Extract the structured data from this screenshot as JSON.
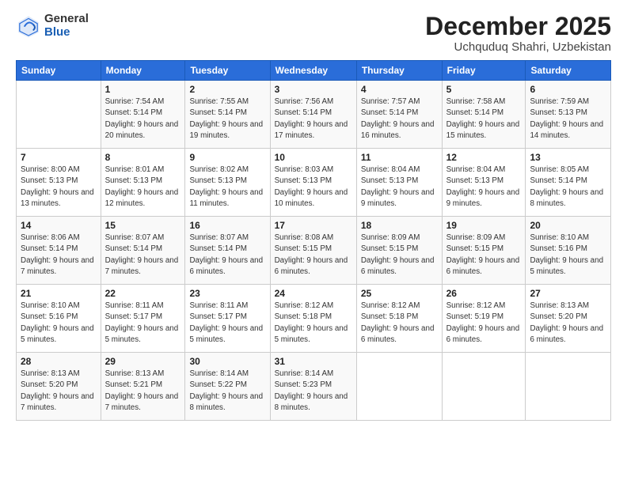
{
  "logo": {
    "general": "General",
    "blue": "Blue"
  },
  "header": {
    "month": "December 2025",
    "location": "Uchquduq Shahri, Uzbekistan"
  },
  "weekdays": [
    "Sunday",
    "Monday",
    "Tuesday",
    "Wednesday",
    "Thursday",
    "Friday",
    "Saturday"
  ],
  "weeks": [
    [
      {
        "day": "",
        "sunrise": "",
        "sunset": "",
        "daylight": ""
      },
      {
        "day": "1",
        "sunrise": "Sunrise: 7:54 AM",
        "sunset": "Sunset: 5:14 PM",
        "daylight": "Daylight: 9 hours and 20 minutes."
      },
      {
        "day": "2",
        "sunrise": "Sunrise: 7:55 AM",
        "sunset": "Sunset: 5:14 PM",
        "daylight": "Daylight: 9 hours and 19 minutes."
      },
      {
        "day": "3",
        "sunrise": "Sunrise: 7:56 AM",
        "sunset": "Sunset: 5:14 PM",
        "daylight": "Daylight: 9 hours and 17 minutes."
      },
      {
        "day": "4",
        "sunrise": "Sunrise: 7:57 AM",
        "sunset": "Sunset: 5:14 PM",
        "daylight": "Daylight: 9 hours and 16 minutes."
      },
      {
        "day": "5",
        "sunrise": "Sunrise: 7:58 AM",
        "sunset": "Sunset: 5:14 PM",
        "daylight": "Daylight: 9 hours and 15 minutes."
      },
      {
        "day": "6",
        "sunrise": "Sunrise: 7:59 AM",
        "sunset": "Sunset: 5:13 PM",
        "daylight": "Daylight: 9 hours and 14 minutes."
      }
    ],
    [
      {
        "day": "7",
        "sunrise": "Sunrise: 8:00 AM",
        "sunset": "Sunset: 5:13 PM",
        "daylight": "Daylight: 9 hours and 13 minutes."
      },
      {
        "day": "8",
        "sunrise": "Sunrise: 8:01 AM",
        "sunset": "Sunset: 5:13 PM",
        "daylight": "Daylight: 9 hours and 12 minutes."
      },
      {
        "day": "9",
        "sunrise": "Sunrise: 8:02 AM",
        "sunset": "Sunset: 5:13 PM",
        "daylight": "Daylight: 9 hours and 11 minutes."
      },
      {
        "day": "10",
        "sunrise": "Sunrise: 8:03 AM",
        "sunset": "Sunset: 5:13 PM",
        "daylight": "Daylight: 9 hours and 10 minutes."
      },
      {
        "day": "11",
        "sunrise": "Sunrise: 8:04 AM",
        "sunset": "Sunset: 5:13 PM",
        "daylight": "Daylight: 9 hours and 9 minutes."
      },
      {
        "day": "12",
        "sunrise": "Sunrise: 8:04 AM",
        "sunset": "Sunset: 5:13 PM",
        "daylight": "Daylight: 9 hours and 9 minutes."
      },
      {
        "day": "13",
        "sunrise": "Sunrise: 8:05 AM",
        "sunset": "Sunset: 5:14 PM",
        "daylight": "Daylight: 9 hours and 8 minutes."
      }
    ],
    [
      {
        "day": "14",
        "sunrise": "Sunrise: 8:06 AM",
        "sunset": "Sunset: 5:14 PM",
        "daylight": "Daylight: 9 hours and 7 minutes."
      },
      {
        "day": "15",
        "sunrise": "Sunrise: 8:07 AM",
        "sunset": "Sunset: 5:14 PM",
        "daylight": "Daylight: 9 hours and 7 minutes."
      },
      {
        "day": "16",
        "sunrise": "Sunrise: 8:07 AM",
        "sunset": "Sunset: 5:14 PM",
        "daylight": "Daylight: 9 hours and 6 minutes."
      },
      {
        "day": "17",
        "sunrise": "Sunrise: 8:08 AM",
        "sunset": "Sunset: 5:15 PM",
        "daylight": "Daylight: 9 hours and 6 minutes."
      },
      {
        "day": "18",
        "sunrise": "Sunrise: 8:09 AM",
        "sunset": "Sunset: 5:15 PM",
        "daylight": "Daylight: 9 hours and 6 minutes."
      },
      {
        "day": "19",
        "sunrise": "Sunrise: 8:09 AM",
        "sunset": "Sunset: 5:15 PM",
        "daylight": "Daylight: 9 hours and 6 minutes."
      },
      {
        "day": "20",
        "sunrise": "Sunrise: 8:10 AM",
        "sunset": "Sunset: 5:16 PM",
        "daylight": "Daylight: 9 hours and 5 minutes."
      }
    ],
    [
      {
        "day": "21",
        "sunrise": "Sunrise: 8:10 AM",
        "sunset": "Sunset: 5:16 PM",
        "daylight": "Daylight: 9 hours and 5 minutes."
      },
      {
        "day": "22",
        "sunrise": "Sunrise: 8:11 AM",
        "sunset": "Sunset: 5:17 PM",
        "daylight": "Daylight: 9 hours and 5 minutes."
      },
      {
        "day": "23",
        "sunrise": "Sunrise: 8:11 AM",
        "sunset": "Sunset: 5:17 PM",
        "daylight": "Daylight: 9 hours and 5 minutes."
      },
      {
        "day": "24",
        "sunrise": "Sunrise: 8:12 AM",
        "sunset": "Sunset: 5:18 PM",
        "daylight": "Daylight: 9 hours and 5 minutes."
      },
      {
        "day": "25",
        "sunrise": "Sunrise: 8:12 AM",
        "sunset": "Sunset: 5:18 PM",
        "daylight": "Daylight: 9 hours and 6 minutes."
      },
      {
        "day": "26",
        "sunrise": "Sunrise: 8:12 AM",
        "sunset": "Sunset: 5:19 PM",
        "daylight": "Daylight: 9 hours and 6 minutes."
      },
      {
        "day": "27",
        "sunrise": "Sunrise: 8:13 AM",
        "sunset": "Sunset: 5:20 PM",
        "daylight": "Daylight: 9 hours and 6 minutes."
      }
    ],
    [
      {
        "day": "28",
        "sunrise": "Sunrise: 8:13 AM",
        "sunset": "Sunset: 5:20 PM",
        "daylight": "Daylight: 9 hours and 7 minutes."
      },
      {
        "day": "29",
        "sunrise": "Sunrise: 8:13 AM",
        "sunset": "Sunset: 5:21 PM",
        "daylight": "Daylight: 9 hours and 7 minutes."
      },
      {
        "day": "30",
        "sunrise": "Sunrise: 8:14 AM",
        "sunset": "Sunset: 5:22 PM",
        "daylight": "Daylight: 9 hours and 8 minutes."
      },
      {
        "day": "31",
        "sunrise": "Sunrise: 8:14 AM",
        "sunset": "Sunset: 5:23 PM",
        "daylight": "Daylight: 9 hours and 8 minutes."
      },
      {
        "day": "",
        "sunrise": "",
        "sunset": "",
        "daylight": ""
      },
      {
        "day": "",
        "sunrise": "",
        "sunset": "",
        "daylight": ""
      },
      {
        "day": "",
        "sunrise": "",
        "sunset": "",
        "daylight": ""
      }
    ]
  ]
}
